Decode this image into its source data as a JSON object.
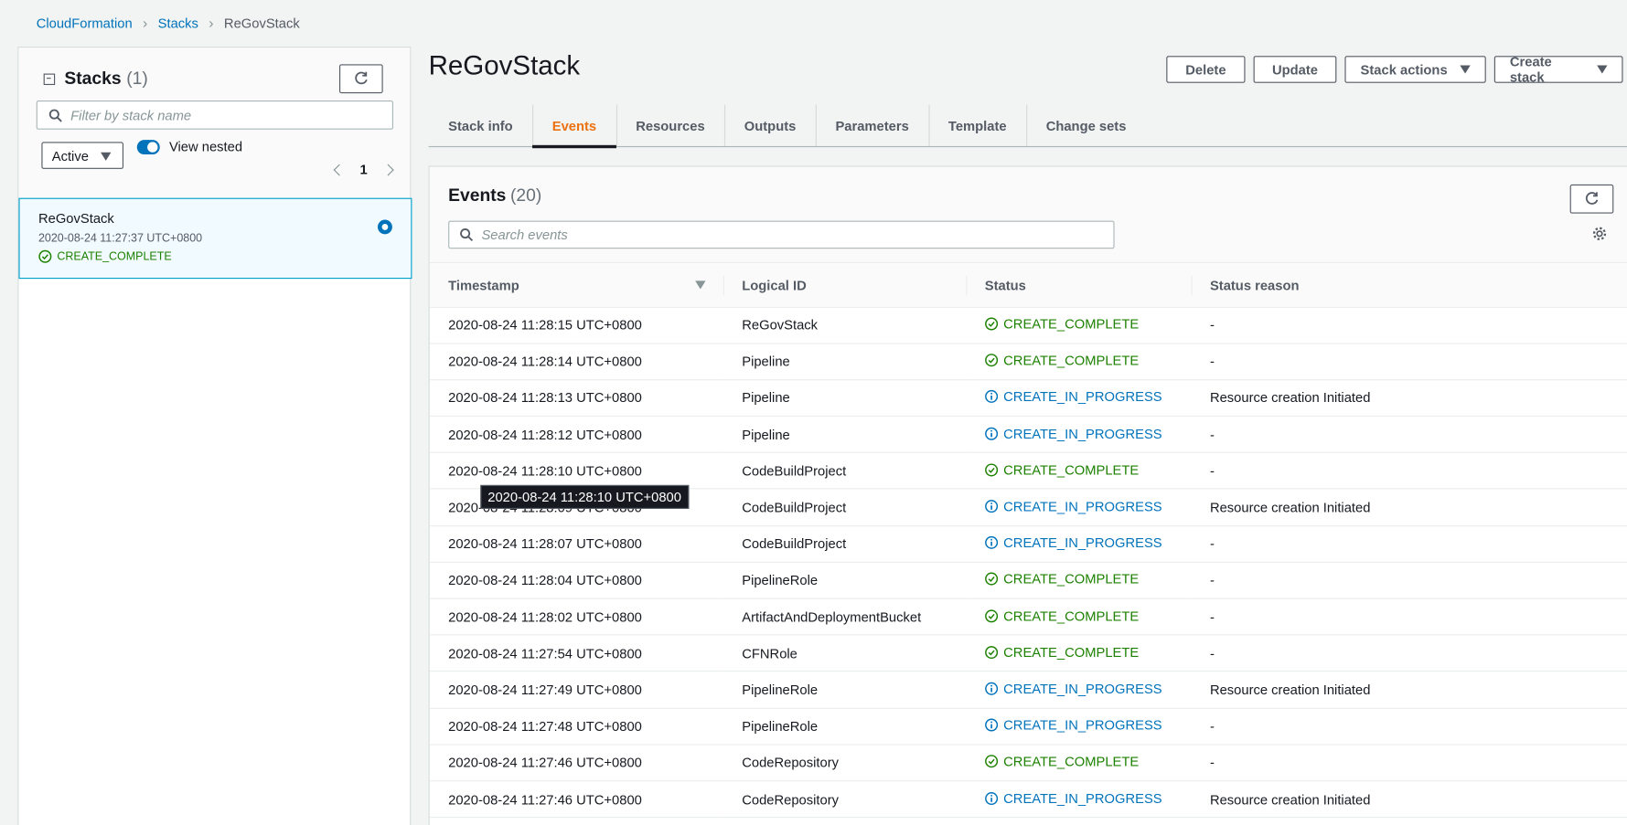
{
  "breadcrumb": {
    "root": "CloudFormation",
    "section": "Stacks",
    "current": "ReGovStack"
  },
  "stacks_panel": {
    "title": "Stacks",
    "count": "(1)",
    "search_placeholder": "Filter by stack name",
    "filter_value": "Active",
    "view_nested_label": "View nested",
    "page": "1",
    "stack": {
      "name": "ReGovStack",
      "time": "2020-08-24 11:27:37 UTC+0800",
      "status": "CREATE_COMPLETE"
    }
  },
  "header": {
    "title": "ReGovStack",
    "buttons": {
      "delete": "Delete",
      "update": "Update",
      "stack_actions": "Stack actions",
      "create_stack": "Create stack"
    }
  },
  "tabs": [
    "Stack info",
    "Events",
    "Resources",
    "Outputs",
    "Parameters",
    "Template",
    "Change sets"
  ],
  "active_tab": "Events",
  "events": {
    "title": "Events",
    "count": "(20)",
    "search_placeholder": "Search events",
    "columns": [
      "Timestamp",
      "Logical ID",
      "Status",
      "Status reason"
    ],
    "rows": [
      {
        "ts": "2020-08-24 11:28:15 UTC+0800",
        "id": "ReGovStack",
        "status": "CREATE_COMPLETE",
        "reason": "-"
      },
      {
        "ts": "2020-08-24 11:28:14 UTC+0800",
        "id": "Pipeline",
        "status": "CREATE_COMPLETE",
        "reason": "-"
      },
      {
        "ts": "2020-08-24 11:28:13 UTC+0800",
        "id": "Pipeline",
        "status": "CREATE_IN_PROGRESS",
        "reason": "Resource creation Initiated"
      },
      {
        "ts": "2020-08-24 11:28:12 UTC+0800",
        "id": "Pipeline",
        "status": "CREATE_IN_PROGRESS",
        "reason": "-"
      },
      {
        "ts": "2020-08-24 11:28:10 UTC+0800",
        "id": "CodeBuildProject",
        "status": "CREATE_COMPLETE",
        "reason": "-"
      },
      {
        "ts": "2020-08-24 11:28:09 UTC+0800",
        "id": "CodeBuildProject",
        "status": "CREATE_IN_PROGRESS",
        "reason": "Resource creation Initiated"
      },
      {
        "ts": "2020-08-24 11:28:07 UTC+0800",
        "id": "CodeBuildProject",
        "status": "CREATE_IN_PROGRESS",
        "reason": "-"
      },
      {
        "ts": "2020-08-24 11:28:04 UTC+0800",
        "id": "PipelineRole",
        "status": "CREATE_COMPLETE",
        "reason": "-"
      },
      {
        "ts": "2020-08-24 11:28:02 UTC+0800",
        "id": "ArtifactAndDeploymentBucket",
        "status": "CREATE_COMPLETE",
        "reason": "-"
      },
      {
        "ts": "2020-08-24 11:27:54 UTC+0800",
        "id": "CFNRole",
        "status": "CREATE_COMPLETE",
        "reason": "-"
      },
      {
        "ts": "2020-08-24 11:27:49 UTC+0800",
        "id": "PipelineRole",
        "status": "CREATE_IN_PROGRESS",
        "reason": "Resource creation Initiated"
      },
      {
        "ts": "2020-08-24 11:27:48 UTC+0800",
        "id": "PipelineRole",
        "status": "CREATE_IN_PROGRESS",
        "reason": "-"
      },
      {
        "ts": "2020-08-24 11:27:46 UTC+0800",
        "id": "CodeRepository",
        "status": "CREATE_COMPLETE",
        "reason": "-"
      },
      {
        "ts": "2020-08-24 11:27:46 UTC+0800",
        "id": "CodeRepository",
        "status": "CREATE_IN_PROGRESS",
        "reason": "Resource creation Initiated"
      }
    ]
  },
  "tooltip": "2020-08-24 11:28:10 UTC+0800",
  "colors": {
    "link": "#0073bb",
    "success": "#1d8102",
    "active_tab": "#ec7211"
  }
}
